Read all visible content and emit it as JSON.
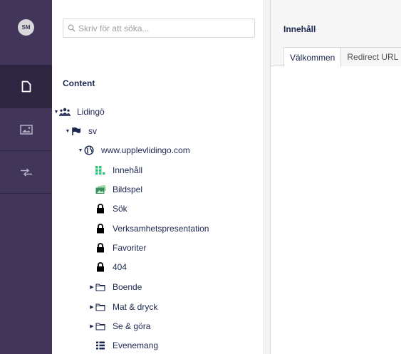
{
  "user": {
    "initials": "SM"
  },
  "rail": {
    "items": [
      {
        "name": "content-section-icon",
        "active": true
      },
      {
        "name": "media-section-icon",
        "active": false
      },
      {
        "name": "redirects-section-icon",
        "active": false
      }
    ]
  },
  "search": {
    "placeholder": "Skriv för att söka..."
  },
  "tree": {
    "title": "Content",
    "nodes": [
      {
        "label": "Lidingö",
        "icon": "users-icon",
        "caret": "down"
      },
      {
        "label": "sv",
        "icon": "flag-icon",
        "caret": "down"
      },
      {
        "label": "www.upplevlidingo.com",
        "icon": "globe-icon",
        "caret": "down"
      },
      {
        "label": "Innehåll",
        "icon": "grid-icon",
        "caret": "none"
      },
      {
        "label": "Bildspel",
        "icon": "slides-icon",
        "caret": "none"
      },
      {
        "label": "Sök",
        "icon": "lock-icon",
        "caret": "none"
      },
      {
        "label": "Verksamhetspresentation",
        "icon": "lock-icon",
        "caret": "none"
      },
      {
        "label": "Favoriter",
        "icon": "lock-icon",
        "caret": "none"
      },
      {
        "label": "404",
        "icon": "lock-icon",
        "caret": "none"
      },
      {
        "label": "Boende",
        "icon": "folder-icon",
        "caret": "right"
      },
      {
        "label": "Mat & dryck",
        "icon": "folder-icon",
        "caret": "right"
      },
      {
        "label": "Se & göra",
        "icon": "folder-icon",
        "caret": "right"
      },
      {
        "label": "Evenemang",
        "icon": "list-icon",
        "caret": "none"
      }
    ]
  },
  "content": {
    "title": "Innehåll",
    "tabs": [
      {
        "label": "Välkommen",
        "active": true
      },
      {
        "label": "Redirect URL",
        "active": false
      }
    ]
  },
  "colors": {
    "rail_bg": "#413659",
    "rail_active": "#2e2640",
    "text_primary": "#1b264f",
    "innehall_icon": "#2bc37c",
    "bildspel_icon": "#3a8f5c"
  }
}
